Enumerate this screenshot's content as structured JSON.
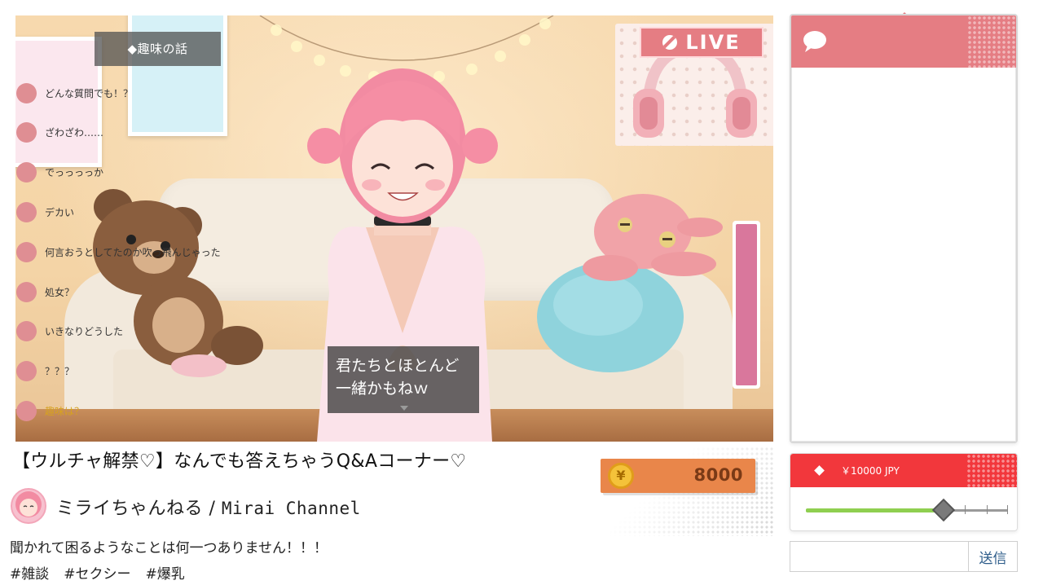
{
  "stream": {
    "topic": "◆趣味の話",
    "live_label": "LIVE",
    "subtitle_line1": "君たちとほとんど",
    "subtitle_line2": "一緒かもねｗ",
    "meter_level": 1.0
  },
  "chat": {
    "messages": [
      {
        "text": "どんな質問でも！？",
        "highlight": false
      },
      {
        "text": "ざわざわ……",
        "highlight": false
      },
      {
        "text": "でっっっっか",
        "highlight": false
      },
      {
        "text": "デカい",
        "highlight": false
      },
      {
        "text": "何言おうとしてたのか吹っ飛んじゃった",
        "highlight": false
      },
      {
        "text": "処女？",
        "highlight": false
      },
      {
        "text": "いきなりどうした",
        "highlight": false
      },
      {
        "text": "？？？",
        "highlight": false
      },
      {
        "text": "趣味は？",
        "highlight": true
      }
    ]
  },
  "superchat": {
    "amount_label": "￥10000 JPY",
    "slider_fraction": 0.68
  },
  "send": {
    "input_value": "",
    "button_label": "送信"
  },
  "info": {
    "title": "【ウルチャ解禁♡】なんでも答えちゃうQ&Aコーナー♡",
    "coin_symbol": "¥",
    "coin_value": "8000",
    "channel_jp": "ミライちゃんねる / ",
    "channel_en": "Mirai Channel",
    "description": "聞かれて困るようなことは何一つありません！！！",
    "tags": [
      "#雑談",
      "#セクシー",
      "#爆乳"
    ]
  },
  "colors": {
    "accent_pink": "#e57d83",
    "superchat_red": "#f2373c",
    "coin_orange": "#e9864a",
    "slider_green": "#8fcf50",
    "highlight_gold": "#d6a21f"
  }
}
